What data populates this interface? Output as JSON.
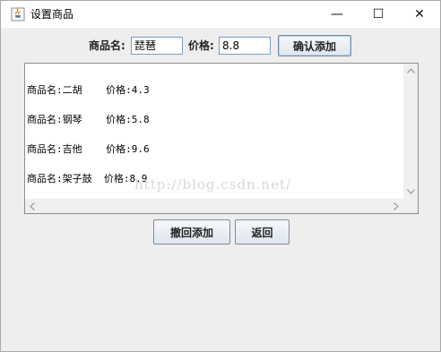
{
  "window": {
    "title": "设置商品",
    "minimize_glyph": "—",
    "maximize_glyph": "☐",
    "close_glyph": "✕"
  },
  "form": {
    "name_label": "商品名:",
    "name_value": "琵琶",
    "price_label": "价格:",
    "price_value": "8.8",
    "confirm_button": "确认添加"
  },
  "goods_list": {
    "lines": [
      "商品名:二胡    价格:4.3",
      "商品名:钢琴    价格:5.8",
      "商品名:吉他    价格:9.6",
      "商品名:架子鼓  价格:8.9"
    ],
    "watermark": "http://blog.csdn.net/"
  },
  "buttons": {
    "undo": "撤回添加",
    "back": "返回"
  },
  "icons": {
    "app": "java-coffee-icon",
    "scroll_up": "chevron-up-icon",
    "scroll_down": "chevron-down-icon",
    "scroll_left": "chevron-left-icon",
    "scroll_right": "chevron-right-icon"
  }
}
